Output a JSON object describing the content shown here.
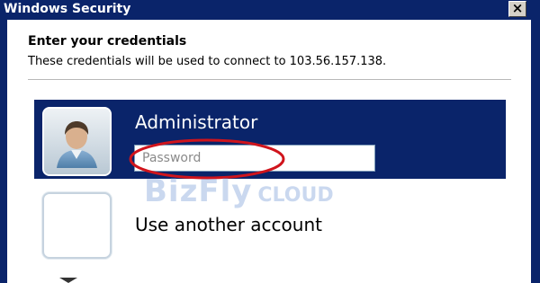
{
  "window": {
    "title": "Windows Security",
    "close_glyph": "×",
    "frame_color": "#0a246a"
  },
  "dialog": {
    "heading": "Enter your credentials",
    "subheading": "These credentials will be used to connect to 103.56.157.138."
  },
  "tiles": {
    "selected": {
      "user_name": "Administrator",
      "avatar_icon": "user-avatar-icon",
      "password_placeholder": "Password",
      "password_value": ""
    },
    "other": {
      "label": "Use another account",
      "avatar_icon": "blank-avatar-icon"
    }
  },
  "annotation": {
    "highlight_color": "#d0141c",
    "shape": "ellipse around password field"
  },
  "watermark": {
    "brand": "BizFly",
    "suffix": "CLOUD"
  },
  "colors": {
    "selected_tile": "#0a246a",
    "accent": "#0a246a"
  }
}
